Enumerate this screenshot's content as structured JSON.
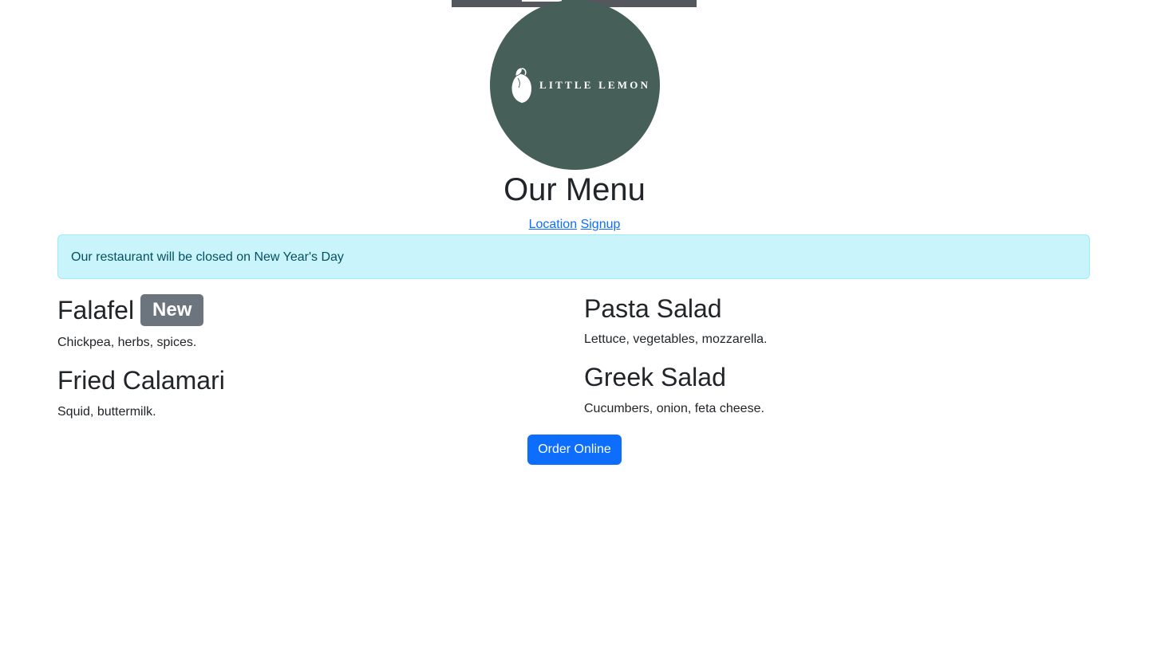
{
  "header": {
    "logo_text": "LITTLE LEMON",
    "logo_alt": "Little Lemon logo",
    "title": "Our Menu"
  },
  "nav": {
    "links": [
      {
        "label": "Location"
      },
      {
        "label": "Signup"
      }
    ]
  },
  "alert": {
    "message": "Our restaurant will be closed on New Year's Day"
  },
  "menu": {
    "items": [
      {
        "name": "Falafel",
        "badge": "New",
        "description": "Chickpea, herbs, spices."
      },
      {
        "name": "Fried Calamari",
        "description": "Squid, buttermilk."
      },
      {
        "name": "Pasta Salad",
        "description": "Lettuce, vegetables, mozzarella."
      },
      {
        "name": "Greek Salad",
        "description": "Cucumbers, onion, feta cheese."
      }
    ]
  },
  "actions": {
    "order_label": "Order Online"
  },
  "colors": {
    "brand": "#465f58",
    "alert_bg": "#c9f4fb",
    "alert_text": "#055160",
    "primary": "#0d6efd",
    "badge": "#6c757d"
  },
  "icons": {
    "logo_mark": "lemon-icon"
  }
}
